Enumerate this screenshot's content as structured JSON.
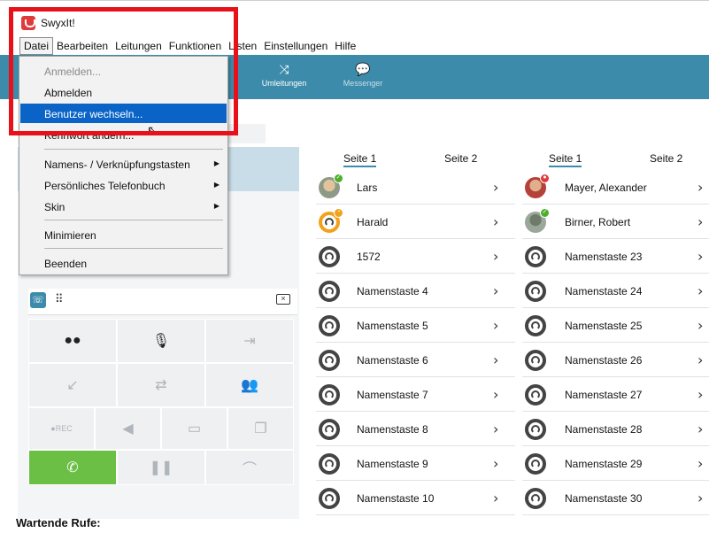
{
  "app": {
    "title": "SwyxIt!"
  },
  "menubar": [
    "Datei",
    "Bearbeiten",
    "Leitungen",
    "Funktionen",
    "Listen",
    "Einstellungen",
    "Hilfe"
  ],
  "toolbar": {
    "umleitungen": "Umleitungen",
    "messenger": "Messenger"
  },
  "dropdown": {
    "anmelden": "Anmelden...",
    "abmelden": "Abmelden",
    "benutzer": "Benutzer wechseln...",
    "kennwort": "Kennwort ändern...",
    "namenstasten": "Namens- / Verknüpfungstasten",
    "telefonbuch": "Persönliches Telefonbuch",
    "skin": "Skin",
    "minimieren": "Minimieren",
    "beenden": "Beenden"
  },
  "controls": {
    "rec": "●REC"
  },
  "pages": {
    "left_selected": "Seite 1",
    "left_other": "Seite 2",
    "right_selected": "Seite 1",
    "right_other": "Seite 2"
  },
  "speed_dial_left": [
    "Lars",
    "Harald",
    "1572",
    "Namenstaste 4",
    "Namenstaste 5",
    "Namenstaste 6",
    "Namenstaste 7",
    "Namenstaste 8",
    "Namenstaste 9",
    "Namenstaste 10"
  ],
  "speed_dial_right": [
    "Mayer, Alexander",
    "Birner, Robert",
    "Namenstaste 23",
    "Namenstaste 24",
    "Namenstaste 25",
    "Namenstaste 26",
    "Namenstaste 27",
    "Namenstaste 28",
    "Namenstaste 29",
    "Namenstaste 30"
  ],
  "footer": {
    "waiting_calls": "Wartende Rufe:"
  },
  "colors": {
    "toolbar": "#3d8bab",
    "highlight": "#0a64c8",
    "callGreen": "#6bbf45",
    "annotation": "#e8111b"
  }
}
